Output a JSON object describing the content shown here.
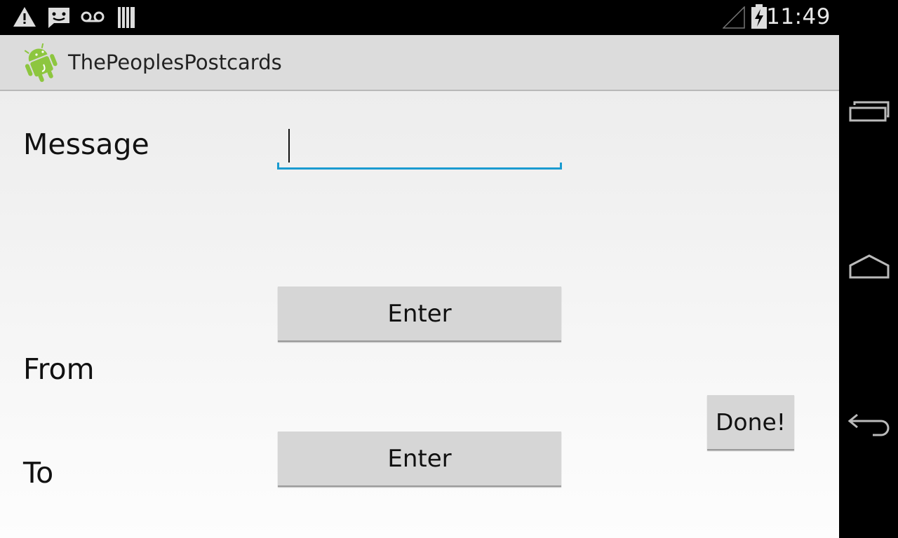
{
  "status_bar": {
    "icons": [
      "warning-icon",
      "sms-icon",
      "voicemail-icon",
      "storage-icon",
      "signal-icon",
      "battery-charging-icon"
    ],
    "clock": "11:49"
  },
  "action_bar": {
    "app_icon": "android-icon",
    "title": "ThePeoplesPostcards"
  },
  "form": {
    "message_label": "Message",
    "message_value": "",
    "from_label": "From",
    "to_label": "To",
    "enter_button_1": "Enter",
    "enter_button_2": "Enter",
    "done_button": "Done!",
    "accent_color": "#1a9bd0"
  },
  "nav_bar": {
    "icons": [
      "recent-apps-icon",
      "home-icon",
      "back-icon"
    ]
  }
}
